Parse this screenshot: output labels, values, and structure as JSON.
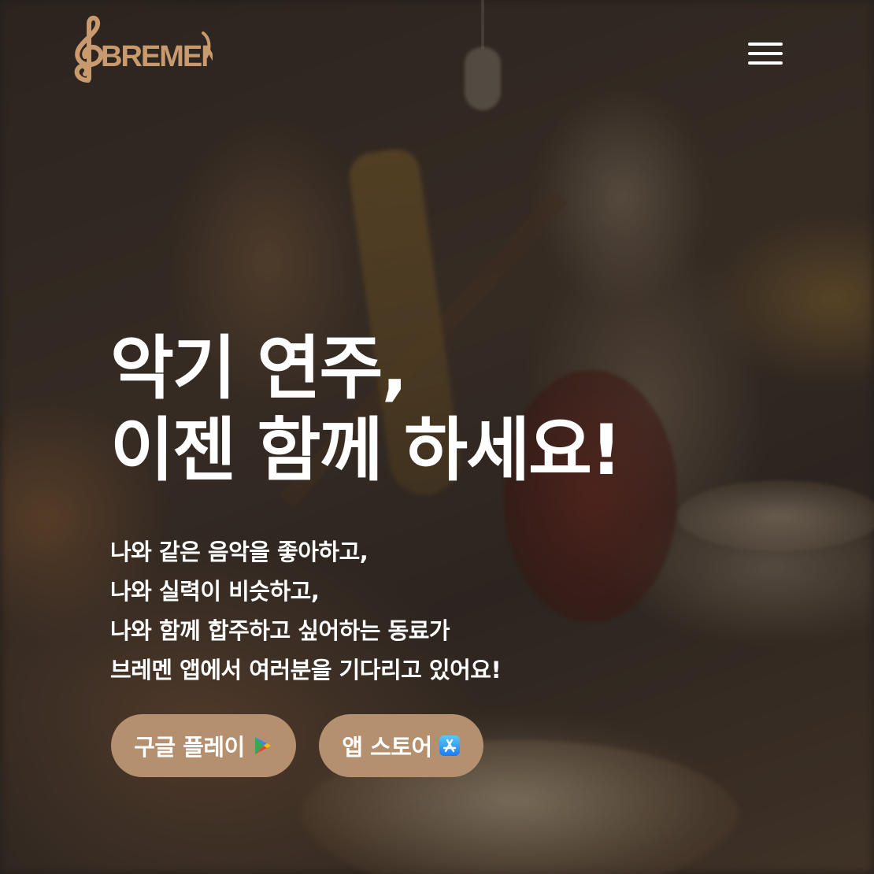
{
  "header": {
    "logo_text": "BREMEN",
    "logo_icon": "treble-clef-icon",
    "menu_icon": "hamburger-menu-icon"
  },
  "hero": {
    "headline": [
      "악기 연주,",
      "이젠 함께 하세요!"
    ],
    "description": [
      "나와 같은 음악을 좋아하고,",
      "나와 실력이 비슷하고,",
      "나와 함께 합주하고 싶어하는 동료가",
      "브레멘 앱에서 여러분을 기다리고 있어요!"
    ]
  },
  "buttons": {
    "google_play_label": "구글 플레이",
    "google_play_icon": "google-play-icon",
    "app_store_label": "앱 스토어",
    "app_store_icon": "app-store-icon"
  },
  "colors": {
    "accent": "#b5906f",
    "logo": "#c89a6e",
    "text": "#ffffff"
  }
}
